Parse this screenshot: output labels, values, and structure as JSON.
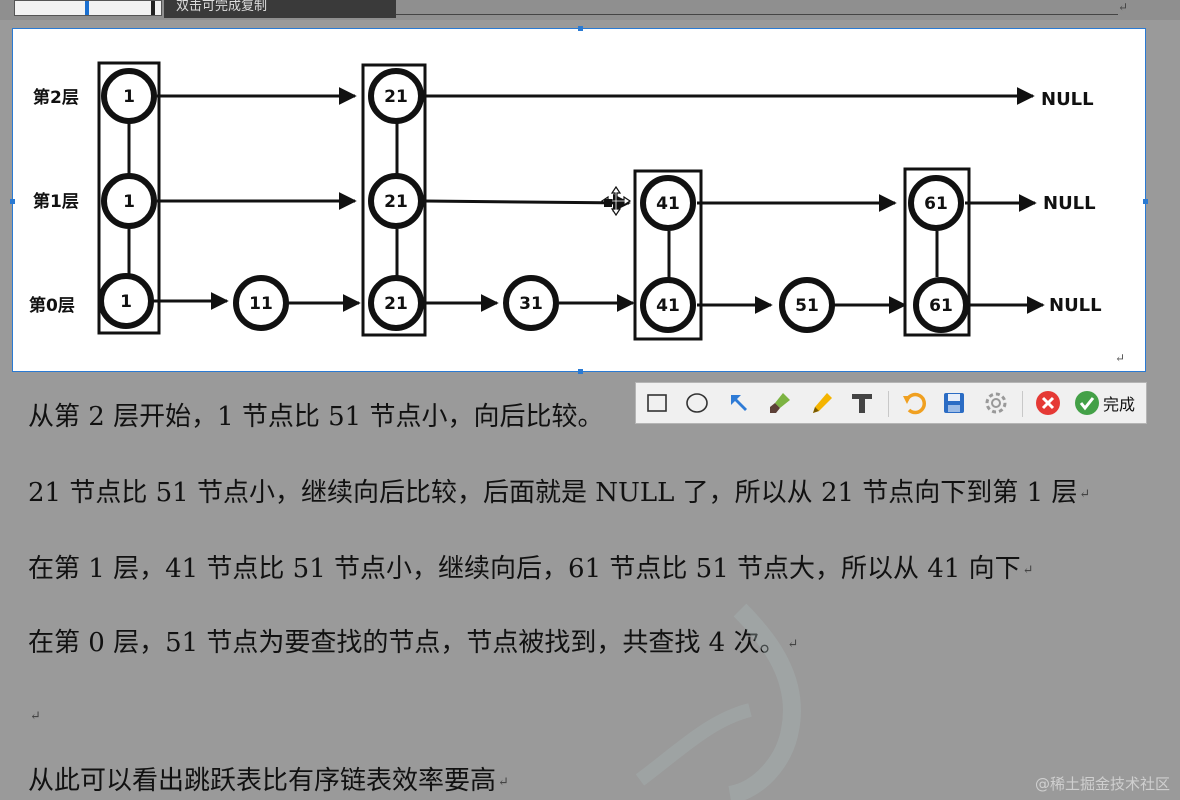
{
  "top_tooltip": "双击可完成复制",
  "diagram": {
    "levels": [
      "第2层",
      "第1层",
      "第0层"
    ],
    "null_label": "NULL",
    "row_level2": [
      "1",
      "21"
    ],
    "row_level1": [
      "1",
      "21",
      "41",
      "61"
    ],
    "row_level0": [
      "1",
      "11",
      "21",
      "31",
      "41",
      "51",
      "61"
    ]
  },
  "toolbar": {
    "icons": [
      "rectangle-icon",
      "ellipse-icon",
      "arrow-icon",
      "brush-icon",
      "pencil-icon",
      "text-icon",
      "undo-icon",
      "save-icon",
      "settings-icon",
      "close-icon",
      "confirm-icon"
    ],
    "done_label": "完成"
  },
  "paragraphs": {
    "p1": "从第 2 层开始，1 节点比 51 节点小，向后比较。",
    "p2": "21 节点比 51 节点小，继续向后比较，后面就是 NULL 了，所以从 21 节点向下到第 1 层",
    "p3": "在第 1 层，41 节点比 51 节点小，继续向后，61 节点比 51 节点大，所以从 41 向下",
    "p4": "在第 0 层，51 节点为要查找的节点，节点被找到，共查找 4 次。",
    "p6": "从此可以看出跳跃表比有序链表效率要高"
  },
  "watermark": "@稀土掘金技术社区"
}
